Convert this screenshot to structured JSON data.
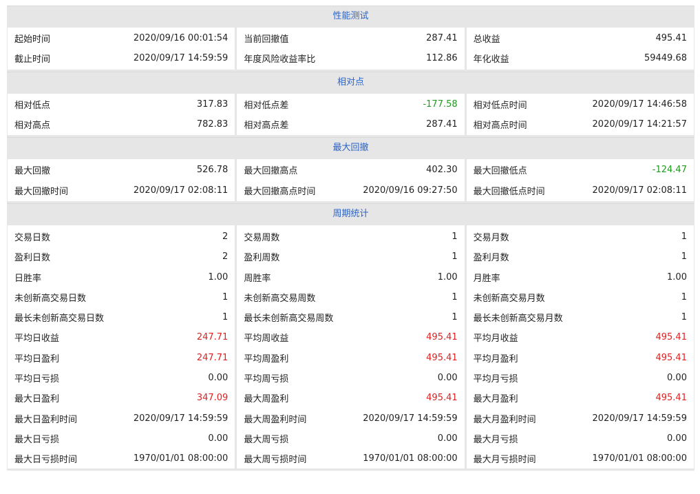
{
  "colors": {
    "header_text": "#2a63c8",
    "positive": "#e02020",
    "negative": "#1e9a1e",
    "background": "#e6e6e6"
  },
  "sections": [
    {
      "title": "性能测试",
      "columns": [
        [
          {
            "label": "起始时间",
            "value": "2020/09/16 00:01:54"
          },
          {
            "label": "截止时间",
            "value": "2020/09/17 14:59:59"
          }
        ],
        [
          {
            "label": "当前回撤值",
            "value": "287.41"
          },
          {
            "label": "年度风险收益率比",
            "value": "112.86"
          }
        ],
        [
          {
            "label": "总收益",
            "value": "495.41"
          },
          {
            "label": "年化收益",
            "value": "59449.68"
          }
        ]
      ]
    },
    {
      "title": "相对点",
      "columns": [
        [
          {
            "label": "相对低点",
            "value": "317.83"
          },
          {
            "label": "相对高点",
            "value": "782.83"
          }
        ],
        [
          {
            "label": "相对低点差",
            "value": "-177.58",
            "tone": "green"
          },
          {
            "label": "相对高点差",
            "value": "287.41"
          }
        ],
        [
          {
            "label": "相对低点时间",
            "value": "2020/09/17 14:46:58"
          },
          {
            "label": "相对高点时间",
            "value": "2020/09/17 14:21:57"
          }
        ]
      ]
    },
    {
      "title": "最大回撤",
      "columns": [
        [
          {
            "label": "最大回撤",
            "value": "526.78"
          },
          {
            "label": "最大回撤时间",
            "value": "2020/09/17 02:08:11"
          }
        ],
        [
          {
            "label": "最大回撤高点",
            "value": "402.30"
          },
          {
            "label": "最大回撤高点时间",
            "value": "2020/09/16 09:27:50"
          }
        ],
        [
          {
            "label": "最大回撤低点",
            "value": "-124.47",
            "tone": "green"
          },
          {
            "label": "最大回撤低点时间",
            "value": "2020/09/17 02:08:11"
          }
        ]
      ]
    },
    {
      "title": "周期统计",
      "columns": [
        [
          {
            "label": "交易日数",
            "value": "2"
          },
          {
            "label": "盈利日数",
            "value": "2"
          },
          {
            "label": "日胜率",
            "value": "1.00"
          },
          {
            "label": "未创新高交易日数",
            "value": "1"
          },
          {
            "label": "最长未创新高交易日数",
            "value": "1"
          },
          {
            "label": "平均日收益",
            "value": "247.71",
            "tone": "red"
          },
          {
            "label": "平均日盈利",
            "value": "247.71",
            "tone": "red"
          },
          {
            "label": "平均日亏损",
            "value": "0.00"
          },
          {
            "label": "最大日盈利",
            "value": "347.09",
            "tone": "red"
          },
          {
            "label": "最大日盈利时间",
            "value": "2020/09/17 14:59:59"
          },
          {
            "label": "最大日亏损",
            "value": "0.00"
          },
          {
            "label": "最大日亏损时间",
            "value": "1970/01/01 08:00:00"
          }
        ],
        [
          {
            "label": "交易周数",
            "value": "1"
          },
          {
            "label": "盈利周数",
            "value": "1"
          },
          {
            "label": "周胜率",
            "value": "1.00"
          },
          {
            "label": "未创新高交易周数",
            "value": "1"
          },
          {
            "label": "最长未创新高交易周数",
            "value": "1"
          },
          {
            "label": "平均周收益",
            "value": "495.41",
            "tone": "red"
          },
          {
            "label": "平均周盈利",
            "value": "495.41",
            "tone": "red"
          },
          {
            "label": "平均周亏损",
            "value": "0.00"
          },
          {
            "label": "最大周盈利",
            "value": "495.41",
            "tone": "red"
          },
          {
            "label": "最大周盈利时间",
            "value": "2020/09/17 14:59:59"
          },
          {
            "label": "最大周亏损",
            "value": "0.00"
          },
          {
            "label": "最大周亏损时间",
            "value": "1970/01/01 08:00:00"
          }
        ],
        [
          {
            "label": "交易月数",
            "value": "1"
          },
          {
            "label": "盈利月数",
            "value": "1"
          },
          {
            "label": "月胜率",
            "value": "1.00"
          },
          {
            "label": "未创新高交易月数",
            "value": "1"
          },
          {
            "label": "最长未创新高交易月数",
            "value": "1"
          },
          {
            "label": "平均月收益",
            "value": "495.41",
            "tone": "red"
          },
          {
            "label": "平均月盈利",
            "value": "495.41",
            "tone": "red"
          },
          {
            "label": "平均月亏损",
            "value": "0.00"
          },
          {
            "label": "最大月盈利",
            "value": "495.41",
            "tone": "red"
          },
          {
            "label": "最大月盈利时间",
            "value": "2020/09/17 14:59:59"
          },
          {
            "label": "最大月亏损",
            "value": "0.00"
          },
          {
            "label": "最大月亏损时间",
            "value": "1970/01/01 08:00:00"
          }
        ]
      ]
    }
  ]
}
